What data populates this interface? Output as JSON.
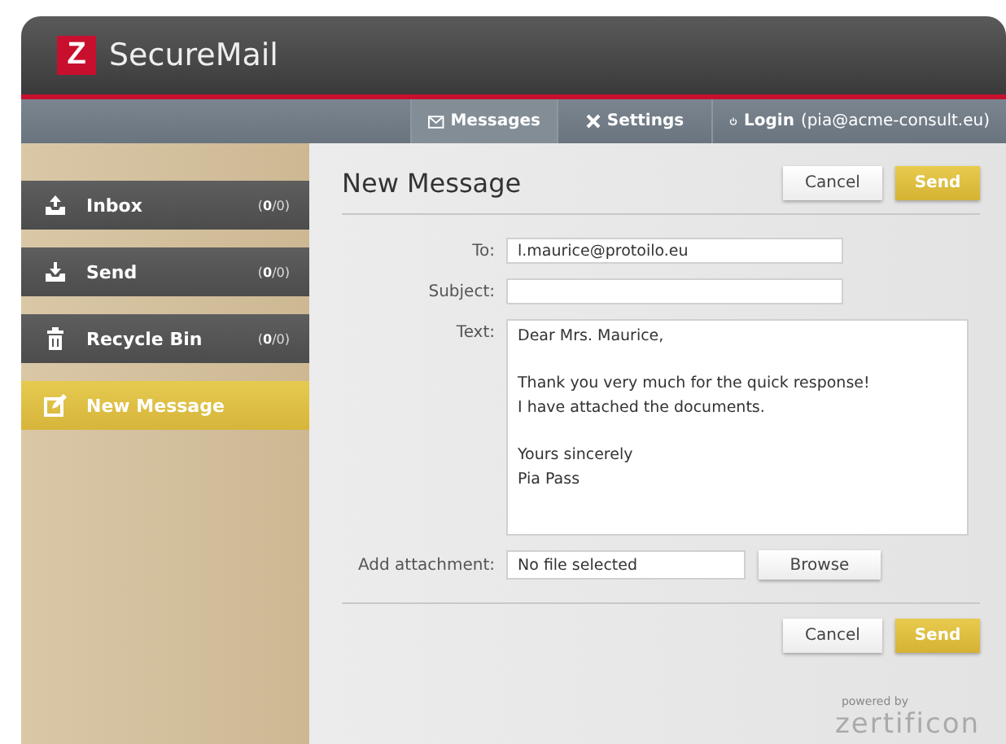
{
  "app": {
    "logo_letter": "Z",
    "title": "SecureMail"
  },
  "nav": [
    {
      "kind": "messages",
      "label": "Messages",
      "selected": true
    },
    {
      "kind": "settings",
      "label": "Settings",
      "selected": false
    },
    {
      "kind": "login",
      "label": "Login",
      "detail": "(pia@acme-consult.eu)",
      "selected": false
    }
  ],
  "sidebar": {
    "items": [
      {
        "kind": "inbox",
        "label": "Inbox",
        "count": "(**0**/0)",
        "selected": false
      },
      {
        "kind": "send",
        "label": "Send",
        "count": "(**0**/0)",
        "selected": false
      },
      {
        "kind": "trash",
        "label": "Recycle Bin",
        "count": "(**0**/0)",
        "selected": false
      },
      {
        "kind": "compose",
        "label": "New Message",
        "selected": true
      }
    ]
  },
  "compose": {
    "title": "New Message",
    "buttons": [
      {
        "kind": "cancel",
        "label": "Cancel"
      },
      {
        "kind": "send",
        "label": "Send"
      }
    ],
    "to": {
      "label": "To:",
      "value": "l.maurice@protoilo.eu"
    },
    "subject": {
      "label": "Subject:"
    },
    "text": {
      "label": "Text:",
      "value": "Dear Mrs. Maurice,\n\nThank you very much for the quick response!\nI have attached the documents.\n\nYours sincerely\nPia Pass"
    },
    "attachment": {
      "label": "Add attachment:",
      "value": "No file selected",
      "button": "Browse"
    },
    "bottom_buttons": [
      {
        "kind": "cancel",
        "label": "Cancel"
      },
      {
        "kind": "send",
        "label": "Send"
      }
    ]
  },
  "footer": {
    "powered_by": "powered by",
    "brand": "zertificon"
  }
}
